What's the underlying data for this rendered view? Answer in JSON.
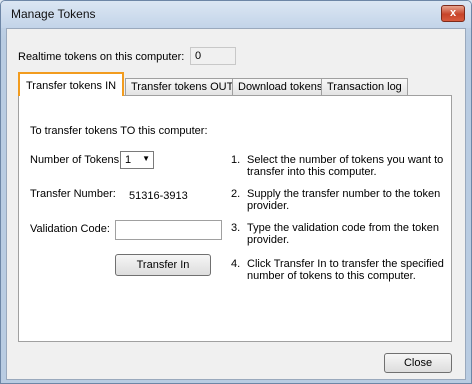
{
  "window": {
    "title": "Manage Tokens",
    "close_glyph": "x"
  },
  "realtime": {
    "label": "Realtime tokens on this computer:",
    "value": "0"
  },
  "tabs": [
    {
      "label": "Transfer tokens IN",
      "active": true
    },
    {
      "label": "Transfer tokens OUT",
      "active": false
    },
    {
      "label": "Download tokens",
      "active": false
    },
    {
      "label": "Transaction log",
      "active": false
    }
  ],
  "transfer_in": {
    "heading": "To transfer tokens TO this computer:",
    "number_of_tokens_label": "Number of Tokens:",
    "number_of_tokens_value": "1",
    "transfer_number_label": "Transfer Number:",
    "transfer_number_value": "51316-3913",
    "validation_code_label": "Validation Code:",
    "validation_code_value": "",
    "transfer_button": "Transfer In",
    "steps": [
      {
        "num": "1.",
        "text": "Select the number of tokens you want to transfer into this computer."
      },
      {
        "num": "2.",
        "text": "Supply the transfer number to the token provider."
      },
      {
        "num": "3.",
        "text": "Type the validation code from the token provider."
      },
      {
        "num": "4.",
        "text": "Click Transfer In to transfer the specified number of tokens to this computer."
      }
    ]
  },
  "footer": {
    "close_button": "Close"
  },
  "colors": {
    "active_tab_border": "#f29c1f",
    "close_button_red": "#c7442a"
  }
}
